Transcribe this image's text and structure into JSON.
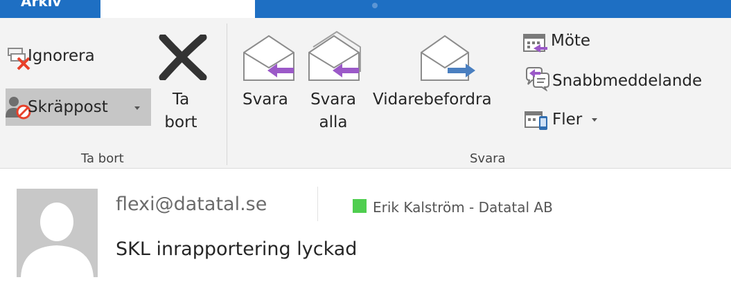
{
  "tabs": {
    "left_tab_fragment": "Arkiv"
  },
  "ribbon": {
    "delete_group": {
      "label": "Ta bort",
      "ignore_label": "Ignorera",
      "junk_label": "Skräppost",
      "delete_line1": "Ta",
      "delete_line2": "bort"
    },
    "respond_group": {
      "label": "Svara",
      "reply_label": "Svara",
      "reply_all_line1": "Svara",
      "reply_all_line2": "alla",
      "forward_label": "Vidarebefordra",
      "meeting_label": "Möte",
      "im_label": "Snabbmeddelande",
      "more_label": "Fler"
    }
  },
  "mail": {
    "sender": "flexi@datatal.se",
    "category": "Erik Kalström - Datatal AB",
    "subject": "SKL inrapportering lyckad"
  },
  "colors": {
    "tab_blue": "#1e6fc3",
    "ribbon_bg": "#f3f3f3",
    "reply_arrow": "#9b59c8",
    "forward_arrow": "#4a7fc0",
    "category_green": "#4fce4f",
    "delete_x": "#333333"
  },
  "icons": {
    "ignore": "ignore-conversation-icon",
    "junk": "junk-mail-icon",
    "delete": "delete-x-icon",
    "reply": "reply-envelope-icon",
    "reply_all": "reply-all-envelope-icon",
    "forward": "forward-envelope-icon",
    "meeting": "meeting-calendar-icon",
    "im": "instant-message-icon",
    "more": "more-respond-icon",
    "avatar": "person-avatar-icon"
  }
}
